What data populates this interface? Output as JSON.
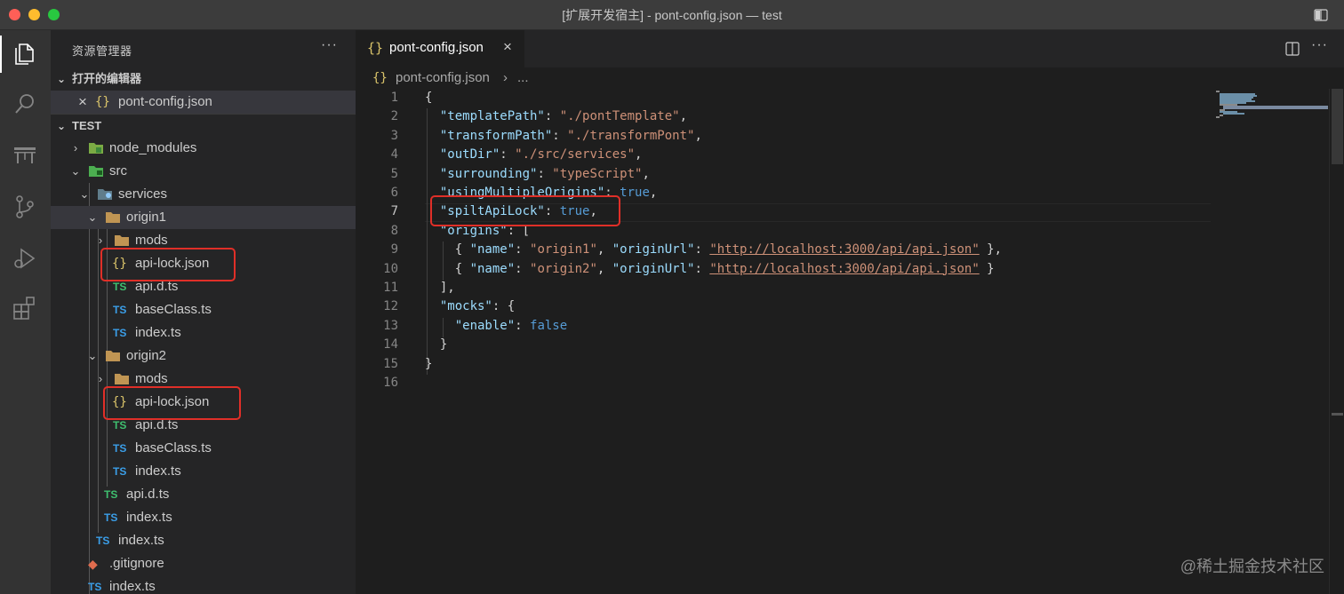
{
  "window": {
    "title": "[扩展开发宿主] - pont-config.json — test"
  },
  "sidebar": {
    "title": "资源管理器",
    "more": "···",
    "open_editors": {
      "label": "打开的编辑器",
      "file": {
        "close": "×",
        "icon": "{}",
        "name": "pont-config.json"
      }
    },
    "project": {
      "label": "TEST",
      "tree": [
        {
          "name": "node_modules",
          "icon": "folder-node-icon",
          "chevron": "›"
        },
        {
          "name": "src",
          "icon": "folder-src-icon",
          "chevron": "⌄"
        },
        {
          "name": "services",
          "icon": "folder-services-icon",
          "chevron": "⌄"
        },
        {
          "name": "origin1",
          "icon": "folder-icon",
          "chevron": "⌄"
        },
        {
          "name": "mods",
          "icon": "folder-icon",
          "chevron": "›"
        },
        {
          "name": "api-lock.json",
          "icon": "{}"
        },
        {
          "name": "api.d.ts",
          "icon": "TS"
        },
        {
          "name": "baseClass.ts",
          "icon": "TS"
        },
        {
          "name": "index.ts",
          "icon": "TS"
        },
        {
          "name": "origin2",
          "icon": "folder-icon",
          "chevron": "⌄"
        },
        {
          "name": "mods",
          "icon": "folder-icon",
          "chevron": "›"
        },
        {
          "name": "api-lock.json",
          "icon": "{}"
        },
        {
          "name": "api.d.ts",
          "icon": "TS"
        },
        {
          "name": "baseClass.ts",
          "icon": "TS"
        },
        {
          "name": "index.ts",
          "icon": "TS"
        },
        {
          "name": "api.d.ts",
          "icon": "TS"
        },
        {
          "name": "index.ts",
          "icon": "TS"
        },
        {
          "name": "index.ts",
          "icon": "TS"
        },
        {
          "name": ".gitignore",
          "icon": "◆"
        },
        {
          "name": "index.ts",
          "icon": "TS"
        }
      ]
    }
  },
  "editor": {
    "tab": {
      "icon": "{}",
      "label": "pont-config.json",
      "close": "×"
    },
    "more": "···",
    "breadcrumb": {
      "icon": "{}",
      "file": "pont-config.json",
      "sep": "›",
      "more": "..."
    },
    "line_numbers": [
      "1",
      "2",
      "3",
      "4",
      "5",
      "6",
      "7",
      "8",
      "9",
      "10",
      "11",
      "12",
      "13",
      "14",
      "15",
      "16"
    ],
    "code": {
      "l1_brace": "{",
      "l2_key": "\"templatePath\"",
      "l2_val": "\"./pontTemplate\"",
      "l3_key": "\"transformPath\"",
      "l3_val": "\"./transformPont\"",
      "l4_key": "\"outDir\"",
      "l4_val": "\"./src/services\"",
      "l5_key": "\"surrounding\"",
      "l5_val": "\"typeScript\"",
      "l6_key": "\"usingMultipleOrigins\"",
      "l6_val": "true",
      "l7_key": "\"spiltApiLock\"",
      "l7_val": "true",
      "l8_key": "\"origins\"",
      "l8_open": "[",
      "name_key": "\"name\"",
      "url_key": "\"originUrl\"",
      "l9_name": "\"origin1\"",
      "l9_url": "\"http://localhost:3000/api/api.json\"",
      "l10_name": "\"origin2\"",
      "l10_url": "\"http://localhost:3000/api/api.json\"",
      "l11_close": "],",
      "l12_key": "\"mocks\"",
      "l12_open": "{",
      "l13_key": "\"enable\"",
      "l13_val": "false",
      "l14_close": "}",
      "l15_close": "}"
    }
  },
  "watermark": "@稀土掘金技术社区"
}
